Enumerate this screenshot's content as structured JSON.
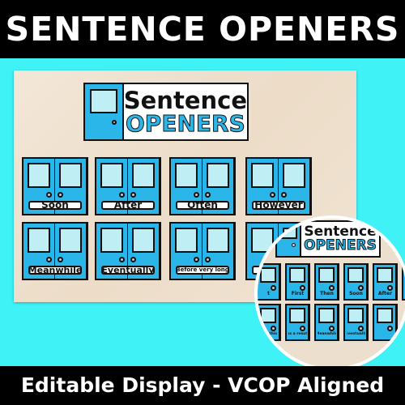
{
  "title": "SENTENCE OPENERS",
  "footer": "Editable Display - VCOP Aligned",
  "colors": {
    "background": "#3ff2f6",
    "door_blue": "#2bb6ea",
    "window": "#bfeef5",
    "bar": "#000000"
  },
  "sign": {
    "line1": "Sentence",
    "line2": "OPENERS"
  },
  "board_cards": [
    "Soon",
    "After",
    "Often",
    "However",
    "Meanwhile",
    "Eventually",
    "Before very long",
    ""
  ],
  "circle": {
    "sign": {
      "line1": "Sentence",
      "line2": "OPENERS"
    },
    "row1": [
      "t",
      "First",
      "Then",
      "Soon",
      "After",
      "In or"
    ],
    "row2": [
      "n to this",
      "As a result",
      "Meanwhile",
      "Eventually",
      ""
    ]
  }
}
